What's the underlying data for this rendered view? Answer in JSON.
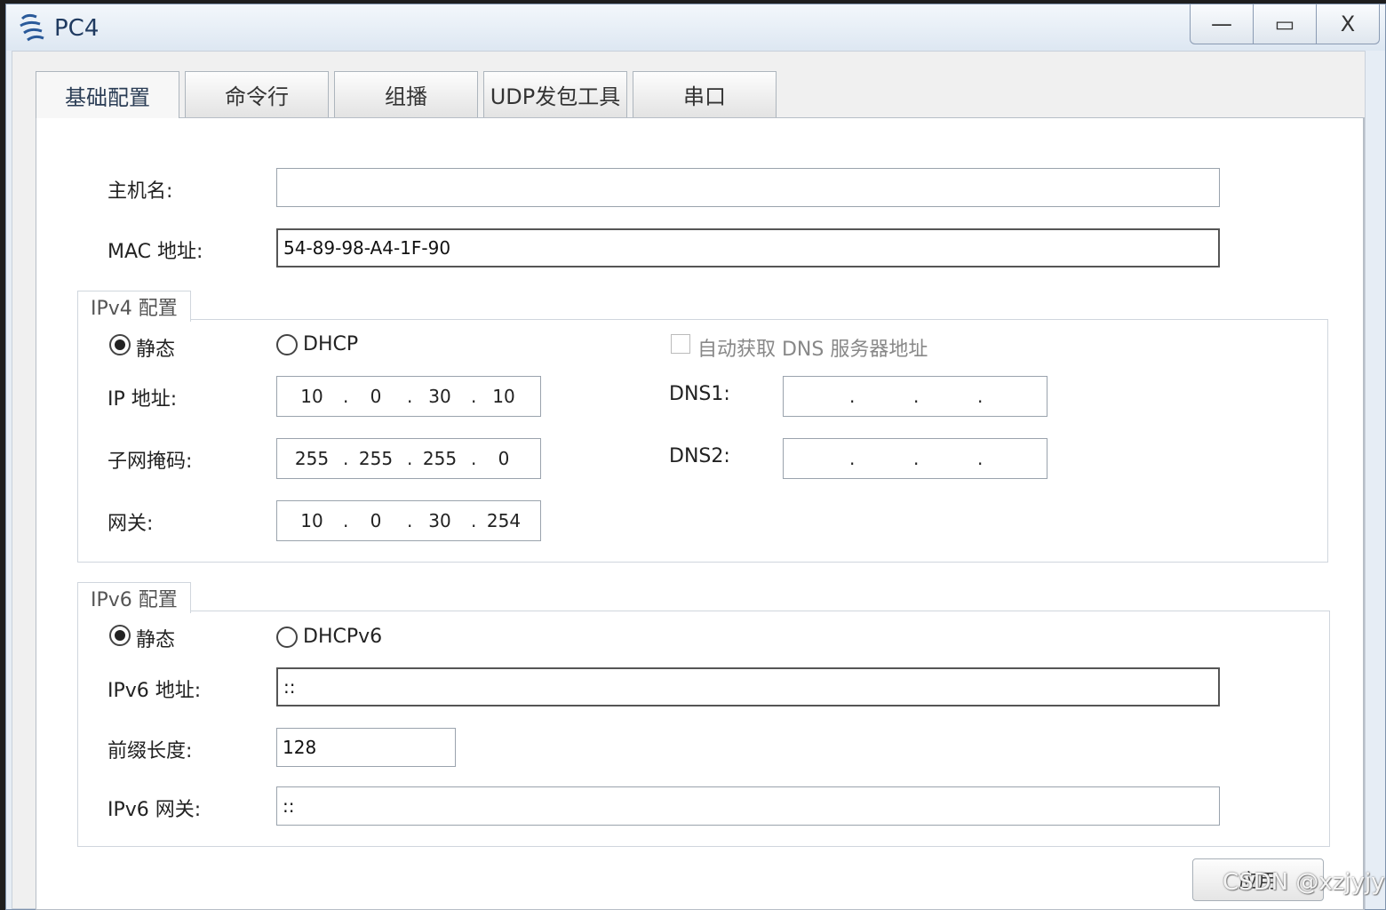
{
  "window": {
    "title": "PC4",
    "minimize_glyph": "—",
    "maximize_glyph": "▭",
    "close_glyph": "X"
  },
  "tabs": [
    {
      "label": "基础配置",
      "active": true
    },
    {
      "label": "命令行",
      "active": false
    },
    {
      "label": "组播",
      "active": false
    },
    {
      "label": "UDP发包工具",
      "active": false
    },
    {
      "label": "串口",
      "active": false
    }
  ],
  "basic": {
    "hostname_label": "主机名:",
    "hostname_value": "",
    "mac_label": "MAC 地址:",
    "mac_value": "54-89-98-A4-1F-90"
  },
  "ipv4": {
    "group_title": "IPv4 配置",
    "static_label": "静态",
    "dhcp_label": "DHCP",
    "mode": "static",
    "auto_dns_label": "自动获取 DNS 服务器地址",
    "auto_dns_checked": false,
    "ip_label": "IP 地址:",
    "ip": [
      "10",
      "0",
      "30",
      "10"
    ],
    "mask_label": "子网掩码:",
    "mask": [
      "255",
      "255",
      "255",
      "0"
    ],
    "gateway_label": "网关:",
    "gateway": [
      "10",
      "0",
      "30",
      "254"
    ],
    "dns1_label": "DNS1:",
    "dns1": [
      "",
      "",
      "",
      ""
    ],
    "dns2_label": "DNS2:",
    "dns2": [
      "",
      "",
      "",
      ""
    ]
  },
  "ipv6": {
    "group_title": "IPv6 配置",
    "static_label": "静态",
    "dhcp_label": "DHCPv6",
    "mode": "static",
    "address_label": "IPv6 地址:",
    "address_value": "::",
    "prefix_label": "前缀长度:",
    "prefix_value": "128",
    "gateway_label": "IPv6 网关:",
    "gateway_value": "::"
  },
  "apply_label": "应用",
  "watermark": "CSDN @xzjyjy",
  "colors": {
    "title_text": "#1f3a60",
    "panel_bg": "#ffffff",
    "frame_bg": "#f0f0f0"
  }
}
